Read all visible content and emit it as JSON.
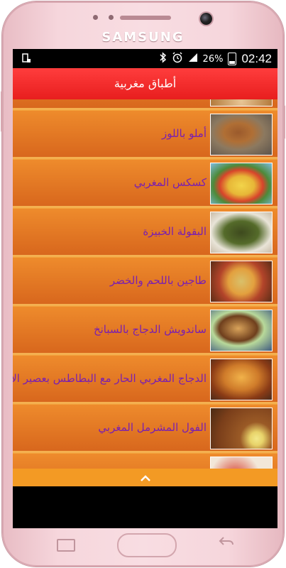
{
  "device": {
    "brand": "SAMSUNG"
  },
  "status": {
    "battery": "26%",
    "time": "02:42"
  },
  "app": {
    "title": "أطباق مغربية"
  },
  "recipes": [
    {
      "title": "أملو باللوز"
    },
    {
      "title": "كسكس المغربي"
    },
    {
      "title": "البقولة الخبيزة"
    },
    {
      "title": "طاجين باللحم والخضر"
    },
    {
      "title": "ساندويش الدجاج بالسبانخ"
    },
    {
      "title": "الدجاج المغربي الحار مع البطاطس بعصير الا"
    },
    {
      "title": "الفول المشرمل المغربي"
    }
  ],
  "colors": {
    "appbar": "#e81e1e",
    "row": "#e27a25",
    "title_text": "#7a1fb0",
    "bottom_bar": "#f39a24"
  }
}
